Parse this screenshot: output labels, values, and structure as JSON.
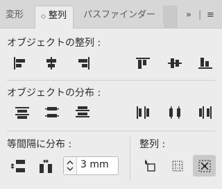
{
  "tabs": [
    {
      "label": "変形",
      "active": false
    },
    {
      "label": "整列",
      "active": true,
      "marker": "◇"
    },
    {
      "label": "パスファインダー",
      "active": false
    }
  ],
  "panel_controls": {
    "expand": "»",
    "menu": "≡"
  },
  "sections": {
    "align_objects": {
      "title": "オブジェクトの整列 :"
    },
    "distribute_objects": {
      "title": "オブジェクトの分布 :"
    },
    "distribute_spacing": {
      "title": "等間隔に分布 :",
      "spacing_value": "3 mm"
    },
    "align_to": {
      "title": "整列 :"
    }
  },
  "icons": {
    "align_objects": [
      "align-left-icon",
      "align-horizontal-center-icon",
      "align-right-icon",
      "align-top-icon",
      "align-vertical-center-icon",
      "align-bottom-icon"
    ],
    "distribute_objects": [
      "distribute-top-icon",
      "distribute-vertical-center-icon",
      "distribute-bottom-icon",
      "distribute-left-icon",
      "distribute-horizontal-center-icon",
      "distribute-right-icon"
    ],
    "distribute_spacing": [
      "vertical-distribute-space-icon",
      "horizontal-distribute-space-icon"
    ],
    "align_to": [
      "align-to-key-object-icon",
      "align-to-artboard-icon",
      "align-to-selection-icon"
    ]
  },
  "colors": {
    "panel_bg": "#ececec",
    "tabbar_bg": "#d7d7d7",
    "icon": "#2f2f2f",
    "selected_button_bg": "#c9c9c9"
  }
}
